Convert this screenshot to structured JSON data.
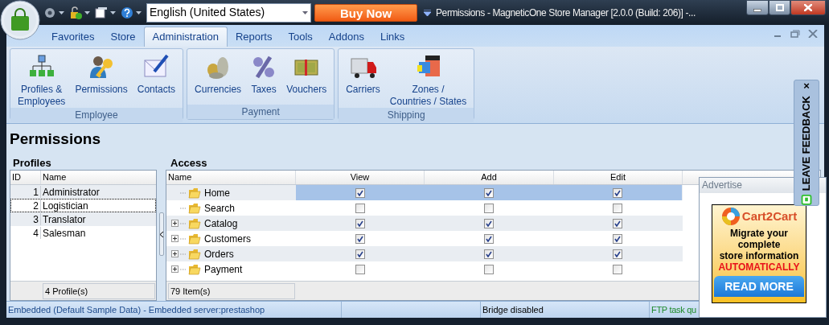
{
  "window": {
    "title": "Permissions - MagneticOne Store Manager [2.0.0 (Build: 206)] -...",
    "language": "English (United States)",
    "buy_button": "Buy Now"
  },
  "ribbon_tabs": [
    {
      "label": "Favorites",
      "selected": false
    },
    {
      "label": "Store",
      "selected": false
    },
    {
      "label": "Administration",
      "selected": true
    },
    {
      "label": "Reports",
      "selected": false
    },
    {
      "label": "Tools",
      "selected": false
    },
    {
      "label": "Addons",
      "selected": false
    },
    {
      "label": "Links",
      "selected": false
    }
  ],
  "ribbon_groups": [
    {
      "label": "Employee",
      "items": [
        {
          "label": "Profiles &\nEmployees",
          "kind": "org"
        },
        {
          "label": "Permissions",
          "kind": "userkey"
        },
        {
          "label": "Contacts",
          "kind": "mail"
        }
      ]
    },
    {
      "label": "Payment",
      "items": [
        {
          "label": "Currencies",
          "kind": "coins"
        },
        {
          "label": "Taxes",
          "kind": "percent"
        },
        {
          "label": "Vouchers",
          "kind": "voucher"
        }
      ]
    },
    {
      "label": "Shipping",
      "items": [
        {
          "label": "Carriers",
          "kind": "truck"
        },
        {
          "label": "Zones /\nCountries / States",
          "kind": "flags"
        }
      ]
    }
  ],
  "page_title": "Permissions",
  "profiles": {
    "title": "Profiles",
    "columns": [
      "ID",
      "Name"
    ],
    "rows": [
      {
        "id": "1",
        "name": "Administrator",
        "focused": false
      },
      {
        "id": "2",
        "name": "Logistician",
        "focused": true
      },
      {
        "id": "3",
        "name": "Translator",
        "focused": false
      },
      {
        "id": "4",
        "name": "Salesman",
        "focused": false
      }
    ],
    "footer": "4 Profile(s)"
  },
  "access": {
    "title": "Access",
    "columns": [
      "Name",
      "View",
      "Add",
      "Edit"
    ],
    "rows": [
      {
        "name": "Home",
        "expandable": false,
        "selected": true,
        "view": true,
        "add": true,
        "edit": true
      },
      {
        "name": "Search",
        "expandable": false,
        "selected": false,
        "view": false,
        "add": false,
        "edit": false
      },
      {
        "name": "Catalog",
        "expandable": true,
        "selected": false,
        "view": true,
        "add": true,
        "edit": true
      },
      {
        "name": "Customers",
        "expandable": true,
        "selected": false,
        "view": true,
        "add": true,
        "edit": true
      },
      {
        "name": "Orders",
        "expandable": true,
        "selected": false,
        "view": true,
        "add": true,
        "edit": true
      },
      {
        "name": "Payment",
        "expandable": true,
        "selected": false,
        "view": false,
        "add": false,
        "edit": false
      }
    ],
    "footer": "79 Item(s)"
  },
  "status_bar": [
    "Embedded (Default Sample Data) - Embedded server:prestashop",
    "Bridge disabled",
    "FTP task qu"
  ],
  "advertise": {
    "title": "Advertise",
    "brand": "Cart2Cart",
    "headline": "Migrate your\ncomplete\nstore information",
    "highlight": "AUTOMATICALLY",
    "button": "READ MORE"
  },
  "feedback_tab": {
    "label": "LEAVE FEEDBACK",
    "close": "×"
  }
}
